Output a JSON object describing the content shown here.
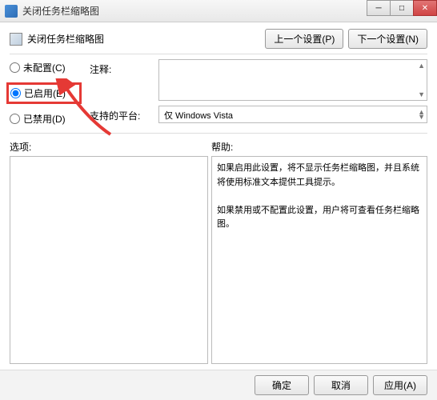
{
  "window": {
    "title": "关闭任务栏缩略图"
  },
  "header": {
    "policy_title": "关闭任务栏缩略图",
    "prev_btn": "上一个设置(P)",
    "next_btn": "下一个设置(N)"
  },
  "radios": {
    "not_configured": "未配置(C)",
    "enabled": "已启用(E)",
    "disabled": "已禁用(D)"
  },
  "fields": {
    "comment_label": "注释:",
    "platform_label": "支持的平台:",
    "platform_value": "仅 Windows Vista"
  },
  "labels": {
    "options": "选项:",
    "help": "帮助:"
  },
  "help": {
    "p1": "如果启用此设置，将不显示任务栏缩略图，并且系统将使用标准文本提供工具提示。",
    "p2": "如果禁用或不配置此设置，用户将可查看任务栏缩略图。"
  },
  "footer": {
    "ok": "确定",
    "cancel": "取消",
    "apply": "应用(A)"
  }
}
